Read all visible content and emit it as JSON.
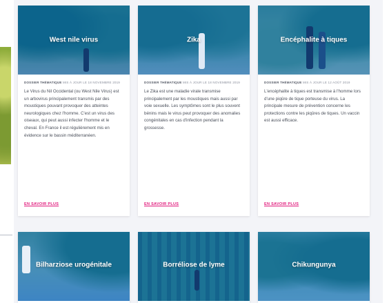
{
  "more_label": "EN SAVOIR PLUS",
  "accent_color": "#e0177a",
  "cards_top": [
    {
      "title": "West nile virus",
      "source": "DOSSIER THÉMATIQUE",
      "date": "MIS À JOUR LE 18 NOVEMBRE 2019",
      "description": "Le Virus du Nil Occidental (ou West Nile Virus) est un arbovirus principalement transmis par des moustiques pouvant provoquer des atteintes neurologiques chez l'homme. C'est un virus des oiseaux, qui peut aussi infecter l'homme et le cheval. En France il est régulièrement mis en évidence sur le bassin méditerranéen."
    },
    {
      "title": "Zika",
      "source": "DOSSIER THÉMATIQUE",
      "date": "MIS À JOUR LE 18 NOVEMBRE 2019",
      "description": "Le Zika est une maladie virale transmise principalement par les moustiques mais aussi par voie sexuelle. Les symptômes sont le plus souvent bénins mais le virus peut provoquer des anomalies congénitales en cas d'infection pendant la grossesse."
    },
    {
      "title": "Encéphalite à tiques",
      "source": "DOSSIER THÉMATIQUE",
      "date": "MIS À JOUR LE 12 AOÛT 2019",
      "description": "L'encéphalite à tiques est transmise à l'homme lors d'une piqûre de tique porteuse du virus. La principale mesure de prévention concerne les protections contre les piqûres de tiques. Un vaccin est aussi efficace."
    }
  ],
  "cards_bottom": [
    {
      "title": "Bilharziose urogénitale"
    },
    {
      "title": "Borréliose de lyme"
    },
    {
      "title": "Chikungunya"
    }
  ]
}
